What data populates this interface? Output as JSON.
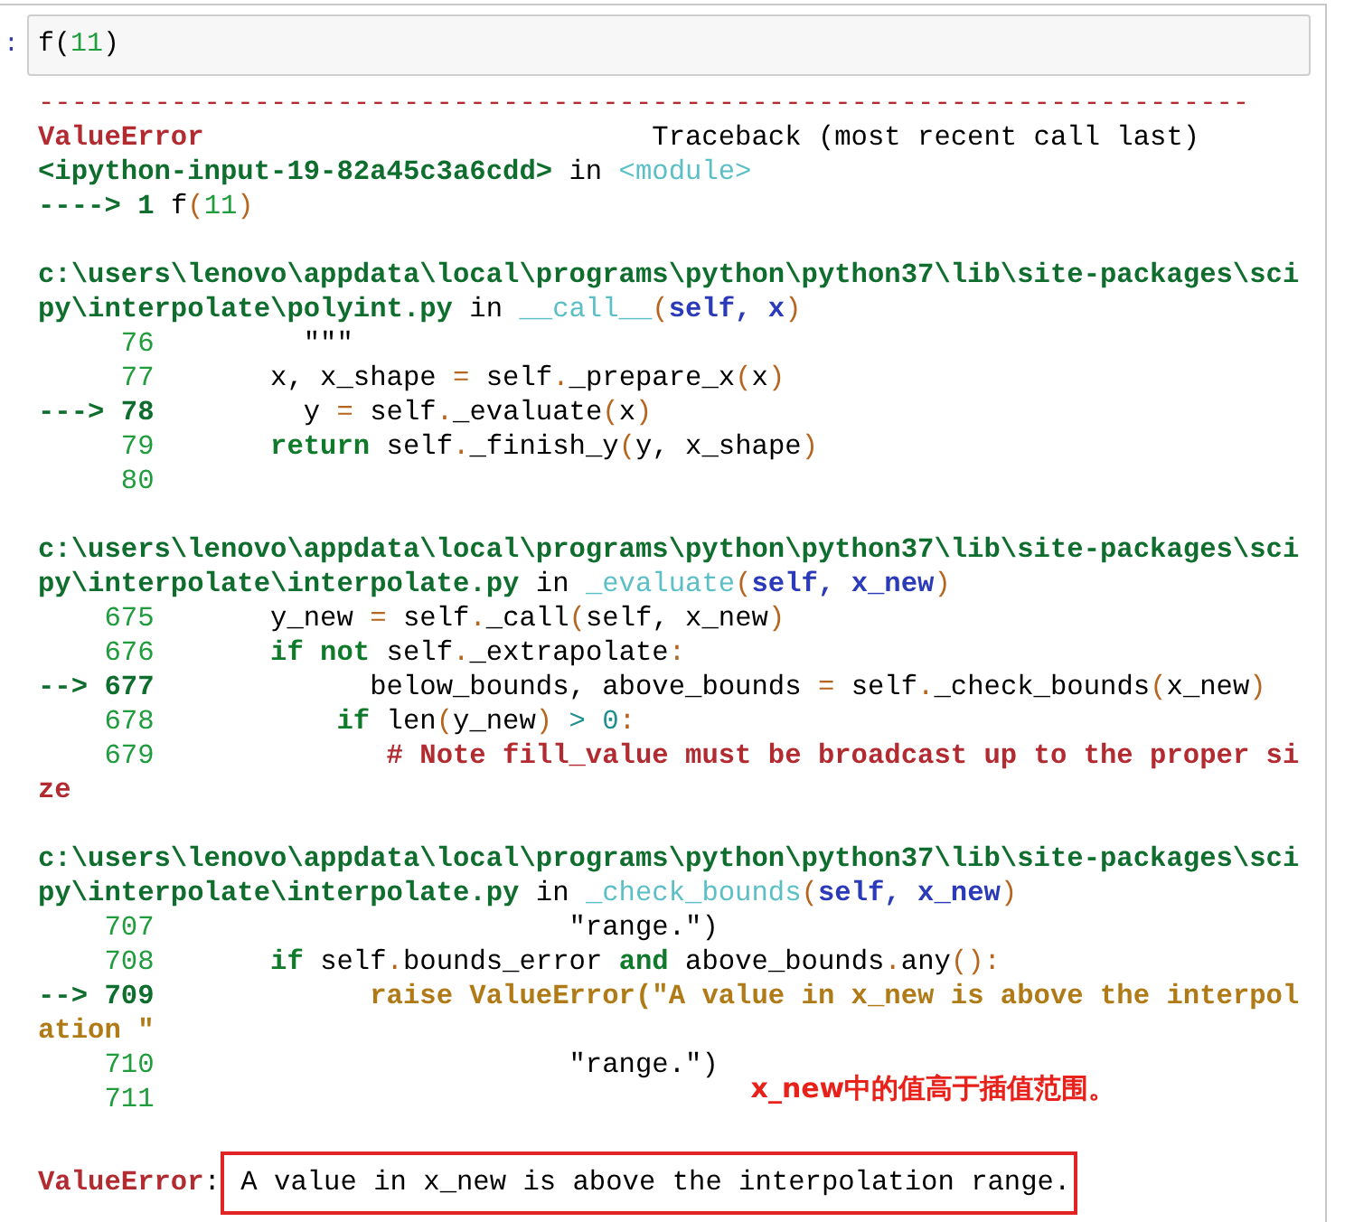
{
  "input_cell": {
    "prompt": ":",
    "segments": [
      {
        "kind": "plain",
        "text": "f("
      },
      {
        "kind": "litnum",
        "text": "11"
      },
      {
        "kind": "plain",
        "text": ")"
      }
    ]
  },
  "traceback": {
    "separator": "-------------------------------------------------------------------------",
    "blocks": [
      {
        "lines": [
          {
            "segments": [
              {
                "kind": "err",
                "text": "ValueError"
              },
              {
                "kind": "plain",
                "text": "                           Traceback (most recent call last)"
              }
            ]
          },
          {
            "segments": [
              {
                "kind": "path",
                "text": "<ipython-input-19-82a45c3a6cdd>"
              },
              {
                "kind": "plain",
                "text": " in "
              },
              {
                "kind": "mod",
                "text": "<module>"
              }
            ]
          },
          {
            "segments": [
              {
                "kind": "cur",
                "text": "----> 1 "
              },
              {
                "kind": "plain",
                "text": "f"
              },
              {
                "kind": "op",
                "text": "("
              },
              {
                "kind": "litnum",
                "text": "11"
              },
              {
                "kind": "op",
                "text": ")"
              }
            ]
          }
        ]
      },
      {
        "lines": [
          {
            "segments": [
              {
                "kind": "path",
                "text": "c:\\users\\lenovo\\appdata\\local\\programs\\python\\python37\\lib\\site-packages\\sci"
              }
            ]
          },
          {
            "segments": [
              {
                "kind": "path",
                "text": "py\\interpolate\\polyint.py"
              },
              {
                "kind": "plain",
                "text": " in "
              },
              {
                "kind": "mod",
                "text": "__call__"
              },
              {
                "kind": "op",
                "text": "("
              },
              {
                "kind": "arg",
                "text": "self, x"
              },
              {
                "kind": "op",
                "text": ")"
              }
            ]
          },
          {
            "segments": [
              {
                "kind": "num",
                "text": "     76"
              },
              {
                "kind": "plain",
                "text": "         \"\"\""
              }
            ]
          },
          {
            "segments": [
              {
                "kind": "num",
                "text": "     77"
              },
              {
                "kind": "plain",
                "text": "       x, x_shape "
              },
              {
                "kind": "op",
                "text": "="
              },
              {
                "kind": "plain",
                "text": " self"
              },
              {
                "kind": "op",
                "text": "."
              },
              {
                "kind": "plain",
                "text": "_prepare_x"
              },
              {
                "kind": "op",
                "text": "("
              },
              {
                "kind": "plain",
                "text": "x"
              },
              {
                "kind": "op",
                "text": ")"
              }
            ]
          },
          {
            "segments": [
              {
                "kind": "cur",
                "text": "---> 78"
              },
              {
                "kind": "plain",
                "text": "         y "
              },
              {
                "kind": "op",
                "text": "="
              },
              {
                "kind": "plain",
                "text": " self"
              },
              {
                "kind": "op",
                "text": "."
              },
              {
                "kind": "plain",
                "text": "_evaluate"
              },
              {
                "kind": "op",
                "text": "("
              },
              {
                "kind": "plain",
                "text": "x"
              },
              {
                "kind": "op",
                "text": ")"
              }
            ]
          },
          {
            "segments": [
              {
                "kind": "num",
                "text": "     79"
              },
              {
                "kind": "kw",
                "text": "       return"
              },
              {
                "kind": "plain",
                "text": " self"
              },
              {
                "kind": "op",
                "text": "."
              },
              {
                "kind": "plain",
                "text": "_finish_y"
              },
              {
                "kind": "op",
                "text": "("
              },
              {
                "kind": "plain",
                "text": "y, x_shape"
              },
              {
                "kind": "op",
                "text": ")"
              }
            ]
          },
          {
            "segments": [
              {
                "kind": "num",
                "text": "     80"
              }
            ]
          }
        ]
      },
      {
        "lines": [
          {
            "segments": [
              {
                "kind": "path",
                "text": "c:\\users\\lenovo\\appdata\\local\\programs\\python\\python37\\lib\\site-packages\\sci"
              }
            ]
          },
          {
            "segments": [
              {
                "kind": "path",
                "text": "py\\interpolate\\interpolate.py"
              },
              {
                "kind": "plain",
                "text": " in "
              },
              {
                "kind": "mod",
                "text": "_evaluate"
              },
              {
                "kind": "op",
                "text": "("
              },
              {
                "kind": "arg",
                "text": "self, x_new"
              },
              {
                "kind": "op",
                "text": ")"
              }
            ]
          },
          {
            "segments": [
              {
                "kind": "num",
                "text": "    675"
              },
              {
                "kind": "plain",
                "text": "       y_new "
              },
              {
                "kind": "op",
                "text": "="
              },
              {
                "kind": "plain",
                "text": " self"
              },
              {
                "kind": "op",
                "text": "."
              },
              {
                "kind": "plain",
                "text": "_call"
              },
              {
                "kind": "op",
                "text": "("
              },
              {
                "kind": "plain",
                "text": "self, x_new"
              },
              {
                "kind": "op",
                "text": ")"
              }
            ]
          },
          {
            "segments": [
              {
                "kind": "num",
                "text": "    676"
              },
              {
                "kind": "kw",
                "text": "       if not"
              },
              {
                "kind": "plain",
                "text": " self"
              },
              {
                "kind": "op",
                "text": "."
              },
              {
                "kind": "plain",
                "text": "_extrapolate"
              },
              {
                "kind": "op",
                "text": ":"
              }
            ]
          },
          {
            "segments": [
              {
                "kind": "cur",
                "text": "--> 677"
              },
              {
                "kind": "plain",
                "text": "             below_bounds, above_bounds "
              },
              {
                "kind": "op",
                "text": "="
              },
              {
                "kind": "plain",
                "text": " self"
              },
              {
                "kind": "op",
                "text": "."
              },
              {
                "kind": "plain",
                "text": "_check_bounds"
              },
              {
                "kind": "op",
                "text": "("
              },
              {
                "kind": "plain",
                "text": "x_new"
              },
              {
                "kind": "op",
                "text": ")"
              }
            ]
          },
          {
            "segments": [
              {
                "kind": "num",
                "text": "    678"
              },
              {
                "kind": "kw",
                "text": "           if"
              },
              {
                "kind": "plain",
                "text": " len"
              },
              {
                "kind": "op",
                "text": "("
              },
              {
                "kind": "plain",
                "text": "y_new"
              },
              {
                "kind": "op",
                "text": ")"
              },
              {
                "kind": "lit",
                "text": " > 0"
              },
              {
                "kind": "op",
                "text": ":"
              }
            ]
          },
          {
            "segments": [
              {
                "kind": "num",
                "text": "    679"
              },
              {
                "kind": "cmt",
                "text": "              # Note fill_value must be broadcast up to the proper si"
              }
            ]
          },
          {
            "segments": [
              {
                "kind": "cmt",
                "text": "ze"
              }
            ]
          }
        ]
      },
      {
        "lines": [
          {
            "segments": [
              {
                "kind": "path",
                "text": "c:\\users\\lenovo\\appdata\\local\\programs\\python\\python37\\lib\\site-packages\\sci"
              }
            ]
          },
          {
            "segments": [
              {
                "kind": "path",
                "text": "py\\interpolate\\interpolate.py"
              },
              {
                "kind": "plain",
                "text": " in "
              },
              {
                "kind": "mod",
                "text": "_check_bounds"
              },
              {
                "kind": "op",
                "text": "("
              },
              {
                "kind": "arg",
                "text": "self, x_new"
              },
              {
                "kind": "op",
                "text": ")"
              }
            ]
          },
          {
            "segments": [
              {
                "kind": "num",
                "text": "    707"
              },
              {
                "kind": "plain",
                "text": "                         \"range.\")"
              }
            ]
          },
          {
            "segments": [
              {
                "kind": "num",
                "text": "    708"
              },
              {
                "kind": "kw",
                "text": "       if"
              },
              {
                "kind": "plain",
                "text": " self"
              },
              {
                "kind": "op",
                "text": "."
              },
              {
                "kind": "plain",
                "text": "bounds_error "
              },
              {
                "kind": "kw",
                "text": "and"
              },
              {
                "kind": "plain",
                "text": " above_bounds"
              },
              {
                "kind": "op",
                "text": "."
              },
              {
                "kind": "plain",
                "text": "any"
              },
              {
                "kind": "op",
                "text": "():"
              }
            ]
          },
          {
            "segments": [
              {
                "kind": "cur",
                "text": "--> 709"
              },
              {
                "kind": "str",
                "text": "             raise ValueError(\"A value in x_new is above the interpol"
              }
            ]
          },
          {
            "segments": [
              {
                "kind": "str",
                "text": "ation \""
              }
            ]
          },
          {
            "segments": [
              {
                "kind": "num",
                "text": "    710"
              },
              {
                "kind": "plain",
                "text": "                         \"range.\")"
              }
            ]
          },
          {
            "segments": [
              {
                "kind": "num",
                "text": "    711"
              }
            ],
            "note": "x_new中的值高于插值范围。"
          }
        ]
      },
      {
        "lines": [
          {
            "segments": [
              {
                "kind": "err",
                "text": "ValueError"
              },
              {
                "kind": "plain",
                "text": ":"
              },
              {
                "kind": "boxed",
                "text": " A value in x_new is above the interpolation range."
              }
            ]
          }
        ]
      }
    ]
  }
}
